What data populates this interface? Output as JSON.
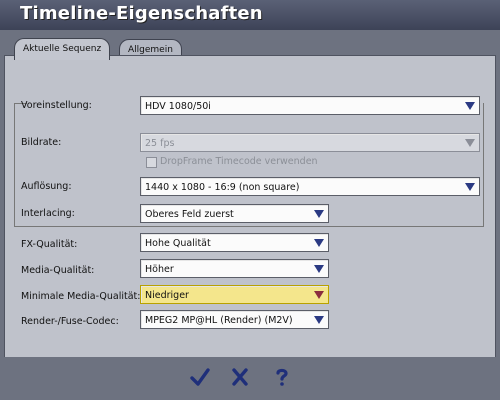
{
  "window": {
    "title": "Timeline-Eigenschaften"
  },
  "tabs": [
    {
      "label": "Aktuelle Sequenz",
      "active": true
    },
    {
      "label": "Allgemein",
      "active": false
    }
  ],
  "fields": {
    "voreinstellung": {
      "label": "Voreinstellung:",
      "value": "HDV 1080/50i"
    },
    "bildrate": {
      "label": "Bildrate:",
      "value": "25 fps",
      "disabled": true
    },
    "dropframe": {
      "label": "DropFrame Timecode verwenden",
      "checked": false,
      "disabled": true
    },
    "aufloesung": {
      "label": "Auflösung:",
      "value": "1440 x 1080 - 16:9 (non square)"
    },
    "interlacing": {
      "label": "Interlacing:",
      "value": "Oberes Feld zuerst"
    },
    "fx_qualitaet": {
      "label": "FX-Qualität:",
      "value": "Hohe Qualität"
    },
    "media_qualitaet": {
      "label": "Media-Qualität:",
      "value": "Höher"
    },
    "min_media_qualitaet": {
      "label": "Minimale Media-Qualität:",
      "value": "Niedriger"
    },
    "render_codec": {
      "label": "Render-/Fuse-Codec:",
      "value": "MPEG2 MP@HL (Render) (M2V)"
    }
  },
  "buttons": {
    "ok": {
      "icon": "check-icon"
    },
    "cancel": {
      "icon": "x-icon"
    },
    "help": {
      "icon": "question-icon"
    }
  },
  "colors": {
    "accent_arrow": "#2b3a83",
    "highlight_field": "#f4e68c",
    "title_bar": "#4a5064"
  }
}
